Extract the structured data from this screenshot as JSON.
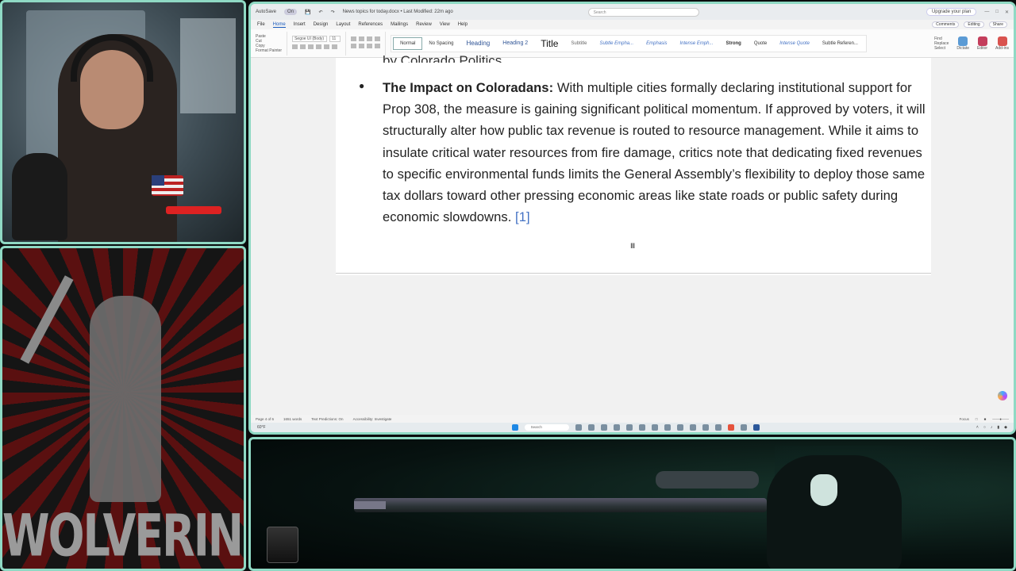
{
  "window": {
    "autosave_label": "AutoSave",
    "autosave_state": "On",
    "doc_title": "News topics for today.docx • Last Modified: 22m ago",
    "search_placeholder": "Search",
    "upgrade_label": "Upgrade your plan"
  },
  "menu": {
    "tabs": [
      "File",
      "Home",
      "Insert",
      "Design",
      "Layout",
      "References",
      "Mailings",
      "Review",
      "View",
      "Help"
    ],
    "active": "Home",
    "comments_label": "Comments",
    "editing_label": "Editing",
    "share_label": "Share"
  },
  "ribbon": {
    "paste": "Paste",
    "cut": "Cut",
    "copy": "Copy",
    "format_painter": "Format Painter",
    "font_name": "Segoe UI (Body)",
    "font_size": "11",
    "styles": [
      "Normal",
      "No Spacing",
      "Heading",
      "Heading 2",
      "Title",
      "Subtitle",
      "Subtle Empha...",
      "Emphasis",
      "Intense Emph...",
      "Strong",
      "Quote",
      "Intense Quote",
      "Subtle Referen..."
    ],
    "find": "Find",
    "replace": "Replace",
    "select": "Select",
    "dictate": "Dictate",
    "editor": "Editor",
    "addins": "Add-ins",
    "group_labels": [
      "Clipboard",
      "Font",
      "Paragraph",
      "Styles",
      "Editing",
      "Voice",
      "Editor",
      "Add-ins"
    ]
  },
  "document": {
    "cut_off_text": "by Colorado Politics.",
    "bullet_lead": "The Impact on Coloradans:",
    "bullet_body": "With multiple cities formally declaring institutional support for Prop 308, the measure is gaining significant political momentum. If approved by voters, it will structurally alter how public tax revenue is routed to resource management. While it aims to insulate critical water resources from fire damage, critics note that dedicating fixed revenues to specific environmental funds limits the General Assembly’s flexibility to deploy those same tax dollars toward other pressing economic areas like state roads or public safety during economic slowdowns.",
    "citation": "[1]"
  },
  "status": {
    "page": "Page 4 of 6",
    "words": "1651 words",
    "text_predictions": "Text Predictions: On",
    "accessibility": "Accessibility: Investigate",
    "focus": "Focus"
  },
  "taskbar": {
    "weather": "60°F",
    "search_label": "Search"
  },
  "poster": {
    "text": "WOLVERINES!!"
  }
}
